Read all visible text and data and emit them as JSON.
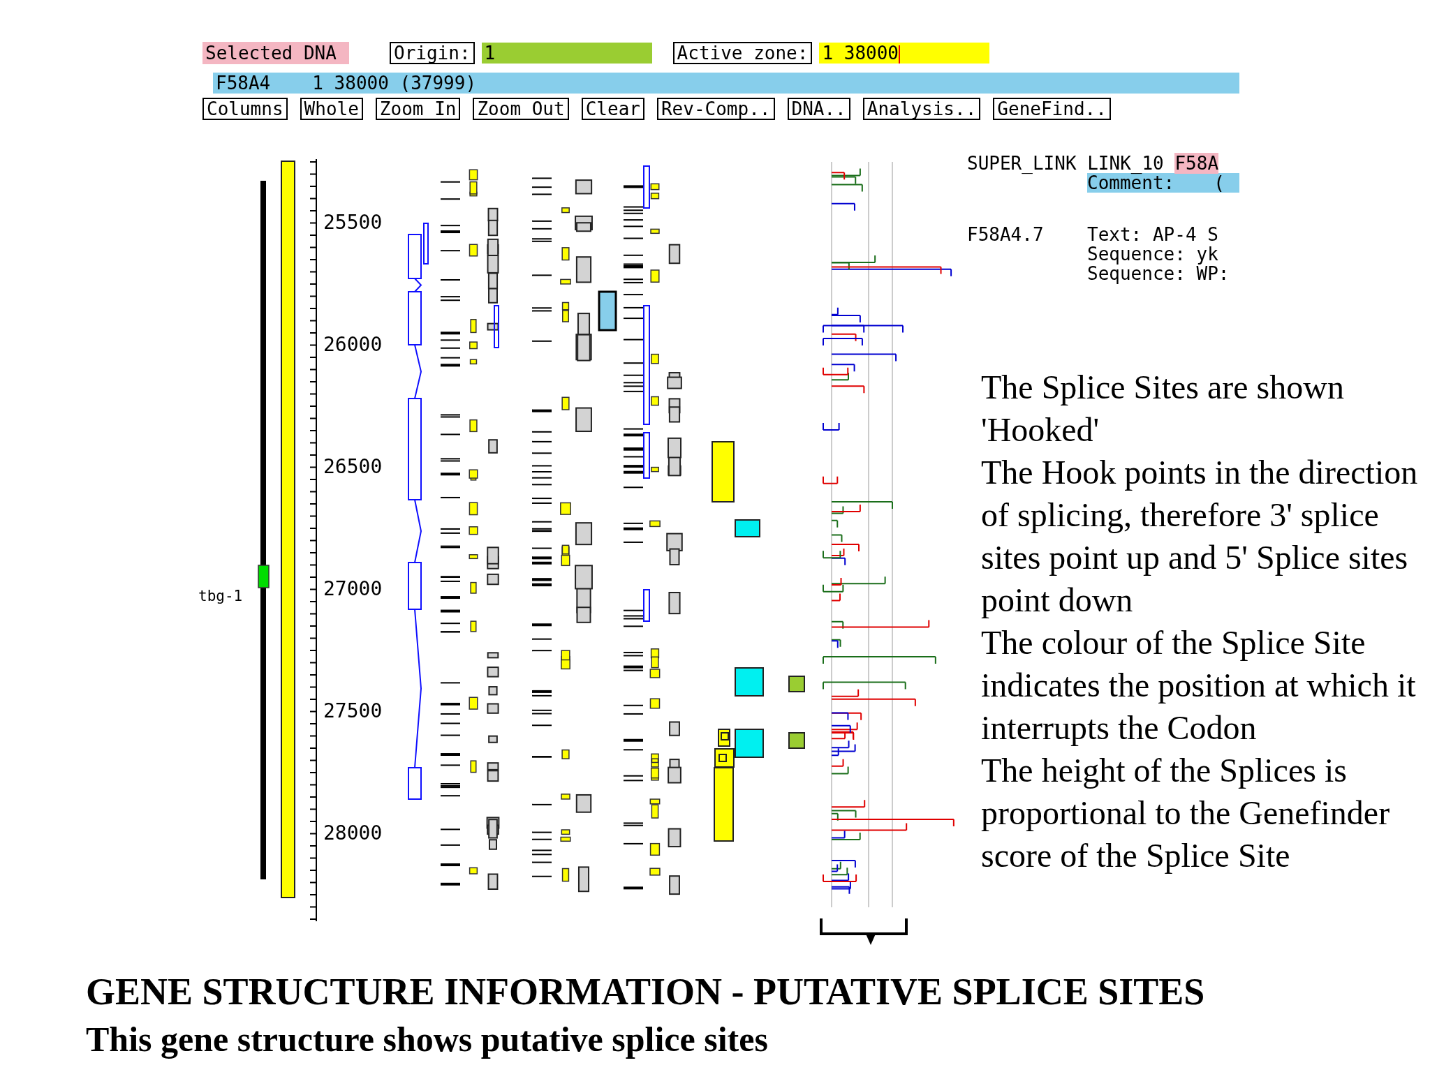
{
  "toolbar": {
    "selection_label": "Selected DNA",
    "origin": {
      "label": "Origin:",
      "value": "1"
    },
    "active_zone": {
      "label": "Active zone:",
      "value": "1 38000"
    }
  },
  "sequence_bar": {
    "name": "F58A4",
    "range": "1 38000 (37999)"
  },
  "buttons": [
    "Columns",
    "Whole",
    "Zoom In",
    "Zoom Out",
    "Clear",
    "Rev-Comp..",
    "DNA..",
    "Analysis..",
    "GeneFind.."
  ],
  "map": {
    "gene_label": "tbg-1",
    "ruler_labels": [
      "25500",
      "26000",
      "26500",
      "27000",
      "27500",
      "28000"
    ]
  },
  "info": {
    "link": "SUPER_LINK LINK_10",
    "link_highlight": "F58A",
    "comment_label": "Comment:",
    "comment_value": "(",
    "gene": "F58A4.7",
    "fields": [
      "Text: AP-4 S",
      "Sequence: yk",
      "Sequence: WP:"
    ]
  },
  "notes": [
    "The Splice Sites are shown 'Hooked'",
    "The Hook points in the direction of splicing, therefore 3' splice sites point up and 5' Splice sites point down",
    "The colour of the Splice Site indicates the position at which it interrupts the Codon",
    "The height of the Splices is proportional to the Genefinder score of the Splice Site"
  ],
  "title": "GENE STRUCTURE INFORMATION - PUTATIVE SPLICE SITES",
  "subtitle": "This gene structure shows putative splice sites"
}
